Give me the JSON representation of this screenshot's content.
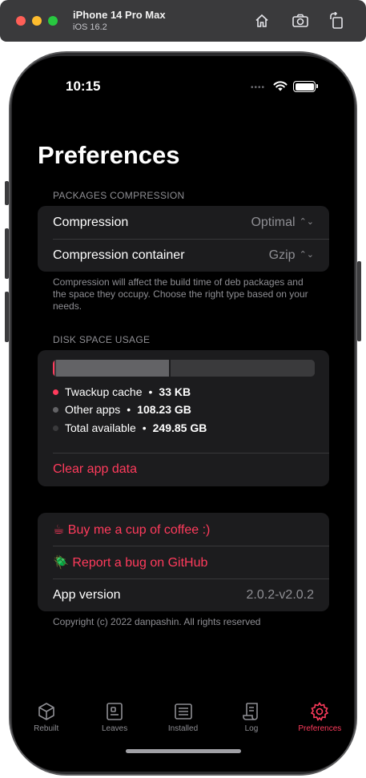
{
  "simulator": {
    "title": "iPhone 14 Pro Max",
    "subtitle": "iOS 16.2",
    "icons": [
      "home-icon",
      "screenshot-icon",
      "rotate-icon"
    ]
  },
  "status_bar": {
    "time": "10:15",
    "dots": "••••"
  },
  "page": {
    "title": "Preferences"
  },
  "compression": {
    "header": "PACKAGES COMPRESSION",
    "rows": [
      {
        "label": "Compression",
        "value": "Optimal"
      },
      {
        "label": "Compression container",
        "value": "Gzip"
      }
    ],
    "footer": "Compression will affect the build time of deb packages and the space they occupy. Choose the right type based on your needs."
  },
  "disk": {
    "header": "DISK SPACE USAGE",
    "usage_fractions": {
      "twackup": 0.006,
      "other": 0.437,
      "free": 0.557
    },
    "colors": {
      "twackup": "#ff3b5c",
      "other": "#636366",
      "free": "#3a3a3c"
    },
    "legend": [
      {
        "label": "Twackup cache",
        "sep": "•",
        "value": "33 KB"
      },
      {
        "label": "Other apps",
        "sep": "•",
        "value": "108.23 GB"
      },
      {
        "label": "Total available",
        "sep": "•",
        "value": "249.85 GB"
      }
    ],
    "clear_label": "Clear app data"
  },
  "about": {
    "coffee_emoji": "☕",
    "coffee_label": "Buy me a cup of coffee :)",
    "bug_emoji": "🪲",
    "bug_label": "Report a bug on GitHub",
    "version_label": "App version",
    "version_value": "2.0.2-v2.0.2",
    "copyright": "Copyright (c) 2022 danpashin. All rights reserved"
  },
  "tabs": [
    {
      "label": "Rebuilt",
      "icon": "cube-icon",
      "active": false
    },
    {
      "label": "Leaves",
      "icon": "leaves-icon",
      "active": false
    },
    {
      "label": "Installed",
      "icon": "installed-icon",
      "active": false
    },
    {
      "label": "Log",
      "icon": "scroll-icon",
      "active": false
    },
    {
      "label": "Preferences",
      "icon": "gear-icon",
      "active": true
    }
  ],
  "accent_color": "#ff3b5c"
}
